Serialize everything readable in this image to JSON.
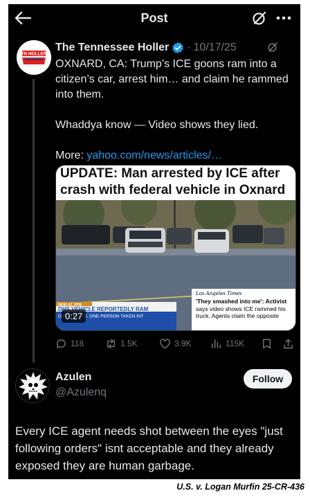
{
  "header": {
    "title": "Post"
  },
  "post": {
    "author": "The Tennessee Holler",
    "logo_text": "TN HOLLER",
    "separator": "·",
    "date": "10/17/25",
    "text_p1": "OXNARD, CA: Trump’s ICE goons ram into a citizen’s car, arrest him… and claim he rammed into them.",
    "text_p2": "Whaddya know — Video shows they lied.",
    "more_label": "More: ",
    "link": "yahoo.com/news/articles/…",
    "media": {
      "headline_line1": "UPDATE: Man arrested by ICE after",
      "headline_line2": "crash with federal vehicle in Oxnard",
      "lower_third_tag": "NEW AT 2PM",
      "lower_third_main": "DHS VEHICLE REPORTEDLY RAM",
      "lower_third_sub": "D PROTESTS. ONE PERSON TAKEN INT",
      "duration": "0:27",
      "news_source": "Los Angeles Times",
      "news_quote": "'They smashed into me': Activist",
      "news_rest": "says video shows ICE rammed his truck. Agents claim the opposite"
    },
    "stats": {
      "replies": "118",
      "reposts": "1.5K",
      "likes": "3.9K",
      "views": "115K"
    }
  },
  "reply": {
    "name": "Azulen",
    "handle": "@Azulenq",
    "follow_label": "Follow",
    "text": "Every ICE agent needs shot between the eyes \"just following orders\" isnt acceptable and they already exposed they are human garbage."
  },
  "caption": "U.S. v. Logan Murfin 25-CR-436",
  "colors": {
    "background": "#000000",
    "text": "#e7e9ea",
    "muted": "#71767b",
    "link": "#1d9bf0",
    "verified": "#1d9bf0"
  }
}
